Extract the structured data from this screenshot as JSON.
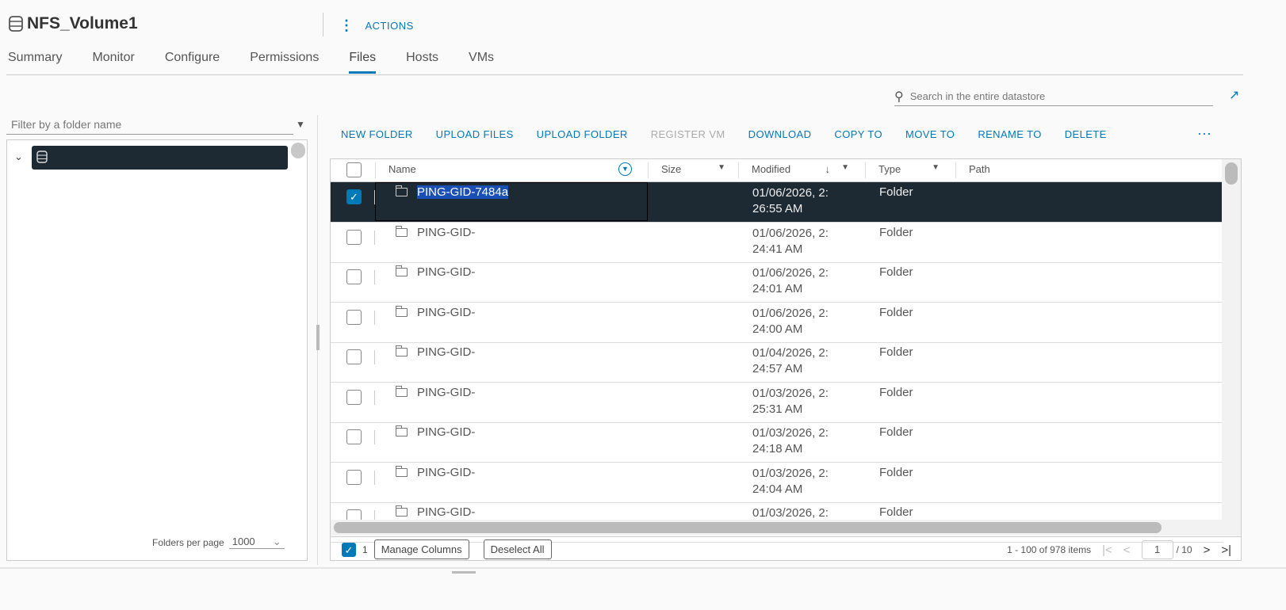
{
  "header": {
    "title": "NFS_Volume1",
    "actions_label": "ACTIONS"
  },
  "tabs": [
    "Summary",
    "Monitor",
    "Configure",
    "Permissions",
    "Files",
    "Hosts",
    "VMs"
  ],
  "active_tab": "Files",
  "search": {
    "placeholder": "Search in the entire datastore"
  },
  "filter": {
    "placeholder": "Filter by a folder name"
  },
  "folders_per_page": {
    "label": "Folders per page",
    "value": "1000"
  },
  "toolbar": [
    "NEW FOLDER",
    "UPLOAD FILES",
    "UPLOAD FOLDER",
    "REGISTER VM",
    "DOWNLOAD",
    "COPY TO",
    "MOVE TO",
    "RENAME TO",
    "DELETE"
  ],
  "columns": [
    "Name",
    "Size",
    "Modified",
    "Type",
    "Path"
  ],
  "rows": [
    {
      "name": "PING-GID-7484a",
      "modified": "01/06/2026, 2:",
      "modified2": "26:55 AM",
      "type": "Folder",
      "selected": true
    },
    {
      "name": "PING-GID-",
      "modified": "01/06/2026, 2:",
      "modified2": "24:41 AM",
      "type": "Folder"
    },
    {
      "name": "PING-GID-",
      "modified": "01/06/2026, 2:",
      "modified2": "24:01 AM",
      "type": "Folder"
    },
    {
      "name": "PING-GID-",
      "modified": "01/06/2026, 2:",
      "modified2": "24:00 AM",
      "type": "Folder"
    },
    {
      "name": "PING-GID-",
      "modified": "01/04/2026, 2:",
      "modified2": "24:57 AM",
      "type": "Folder"
    },
    {
      "name": "PING-GID-",
      "modified": "01/03/2026, 2:",
      "modified2": "25:31 AM",
      "type": "Folder"
    },
    {
      "name": "PING-GID-",
      "modified": "01/03/2026, 2:",
      "modified2": "24:18 AM",
      "type": "Folder"
    },
    {
      "name": "PING-GID-",
      "modified": "01/03/2026, 2:",
      "modified2": "24:04 AM",
      "type": "Folder"
    },
    {
      "name": "PING-GID-",
      "modified": "01/03/2026, 2:",
      "modified2": "",
      "type": "Folder"
    }
  ],
  "footer": {
    "selected_count": "1",
    "manage_columns": "Manage Columns",
    "deselect_all": "Deselect All",
    "range": "1 - 100 of 978 items",
    "page": "1",
    "total_pages": "/ 10"
  }
}
